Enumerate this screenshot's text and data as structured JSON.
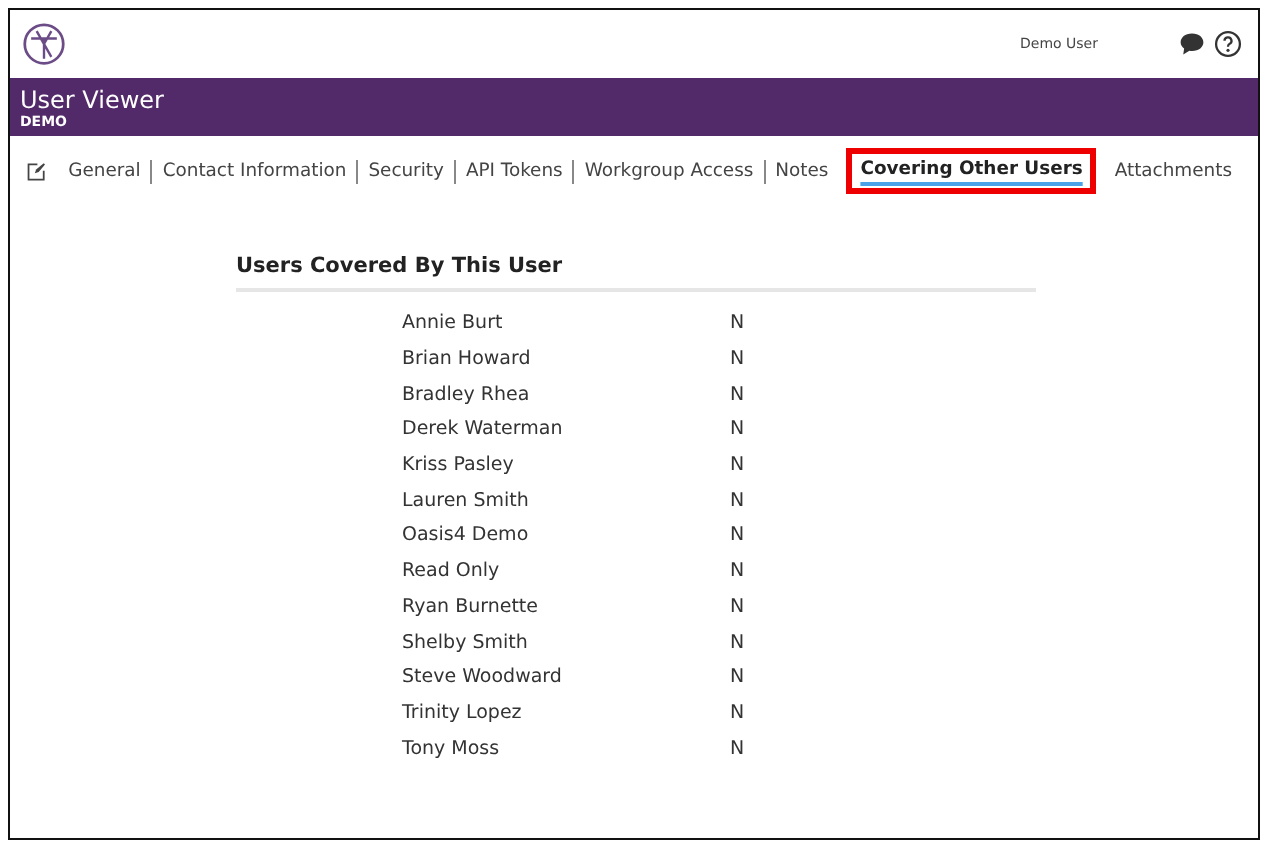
{
  "header": {
    "user": "Demo User"
  },
  "banner": {
    "title": "User Viewer",
    "subtitle": "DEMO"
  },
  "tabs": [
    {
      "label": "General",
      "selected": false
    },
    {
      "label": "Contact Information",
      "selected": false
    },
    {
      "label": "Security",
      "selected": false
    },
    {
      "label": "API Tokens",
      "selected": false
    },
    {
      "label": "Workgroup Access",
      "selected": false
    },
    {
      "label": "Notes",
      "selected": false
    },
    {
      "label": "Covering Other Users",
      "selected": true
    },
    {
      "label": "Attachments",
      "selected": false
    }
  ],
  "section": {
    "title": "Users Covered By This User",
    "rows": [
      {
        "name": "Annie Burt",
        "value": "N"
      },
      {
        "name": "Brian Howard",
        "value": "N"
      },
      {
        "name": "Bradley Rhea",
        "value": "N"
      },
      {
        "name": "Derek Waterman",
        "value": "N"
      },
      {
        "name": "Kriss Pasley",
        "value": "N"
      },
      {
        "name": "Lauren Smith",
        "value": "N"
      },
      {
        "name": "Oasis4 Demo",
        "value": "N"
      },
      {
        "name": "Read Only",
        "value": "N"
      },
      {
        "name": "Ryan Burnette",
        "value": "N"
      },
      {
        "name": "Shelby Smith",
        "value": "N"
      },
      {
        "name": "Steve Woodward",
        "value": "N"
      },
      {
        "name": "Trinity Lopez",
        "value": "N"
      },
      {
        "name": "Tony Moss",
        "value": "N"
      }
    ]
  }
}
